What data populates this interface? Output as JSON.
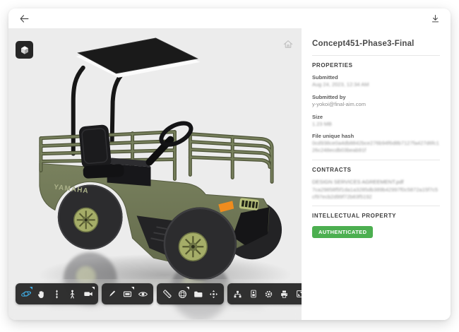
{
  "topbar": {
    "back_icon": "arrow-left",
    "download_icon": "download"
  },
  "viewer": {
    "background_color": "#ececec",
    "model_badge_icon": "3d-cube",
    "home_icon": "home",
    "model": {
      "brand_text": "YAMAHA",
      "description": "olive-green concept utility cart with black canopy, cargo rails and balloon tires",
      "body_color": "#6e7554",
      "rail_color": "#6b7252",
      "tire_color": "#2c2c2e",
      "rim_color": "#a5ad68",
      "canopy_color": "#161616",
      "indicator_color": "#ef8c1e"
    },
    "toolbar": {
      "background_color": "#292929",
      "active_color": "#3fa9e0",
      "groups": [
        {
          "name": "navigation",
          "buttons": [
            {
              "icon": "orbit-icon",
              "active": true,
              "dropdown": true
            },
            {
              "icon": "pan-hand-icon"
            },
            {
              "icon": "zoom-icon"
            },
            {
              "icon": "first-person-icon"
            },
            {
              "icon": "camera-icon",
              "dropdown": true
            }
          ]
        },
        {
          "name": "markup",
          "buttons": [
            {
              "icon": "pen-icon"
            },
            {
              "icon": "screen-icon",
              "dropdown": true
            },
            {
              "icon": "eye-icon"
            }
          ]
        },
        {
          "name": "model-tools",
          "buttons": [
            {
              "icon": "measure-icon"
            },
            {
              "icon": "environment-globe-icon",
              "dropdown": true
            },
            {
              "icon": "folder-icon"
            },
            {
              "icon": "explode-icon"
            }
          ]
        },
        {
          "name": "app-tools",
          "buttons": [
            {
              "icon": "model-browser-icon"
            },
            {
              "icon": "properties-icon"
            },
            {
              "icon": "settings-gear-icon"
            },
            {
              "icon": "print-icon"
            },
            {
              "icon": "fullscreen-icon"
            }
          ]
        }
      ]
    }
  },
  "panel": {
    "title": "Concept451-Phase3-Final",
    "properties": {
      "heading": "PROPERTIES",
      "fields": [
        {
          "label": "Submitted",
          "value": "Aug 24, 2023, 12:34 AM",
          "redacted": true
        },
        {
          "label": "Submitted by",
          "value": "y-yokoi@final-aim.com",
          "redacted": false
        },
        {
          "label": "Size",
          "value": "1.23 MB",
          "redacted": true
        },
        {
          "label": "File unique hash",
          "value": "0cd938ce0a4db8842bce276b94f6d8b7127fa427d6fc126c248ecdb03beab91f",
          "redacted": true
        }
      ]
    },
    "contracts": {
      "heading": "CONTRACTS",
      "file_name": "DESIGN SERVICES AGREEMENT.pdf",
      "file_hash": "7ca29858f5f1da1a3285db389b42997f0c5872a15f7c5cf97ecb2d99f72b83f5192",
      "redacted": true
    },
    "ip": {
      "heading": "INTELLECTUAL PROPERTY",
      "badge": "AUTHENTICATED",
      "badge_color": "#4caf50"
    }
  }
}
